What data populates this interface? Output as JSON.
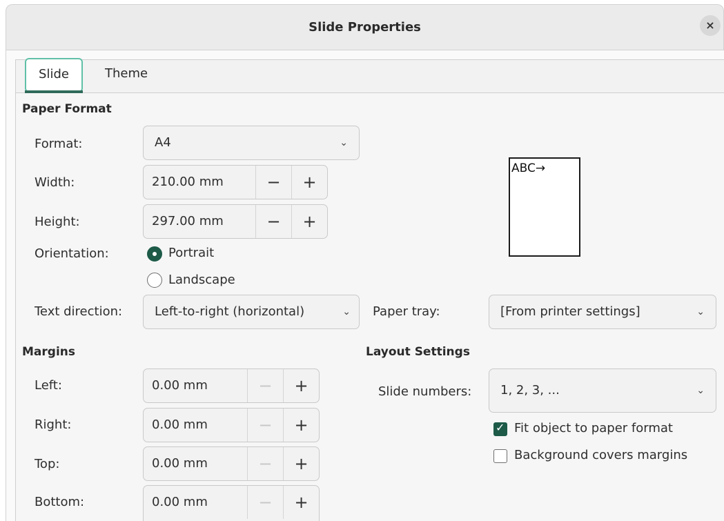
{
  "window": {
    "title": "Slide Properties",
    "close_glyph": "×"
  },
  "tabs": [
    {
      "label": "Slide",
      "active": true
    },
    {
      "label": "Theme",
      "active": false
    }
  ],
  "paper_format": {
    "heading": "Paper Format",
    "format": {
      "label": "Format:",
      "value": "A4"
    },
    "width": {
      "label": "Width:",
      "value": "210.00 mm"
    },
    "height": {
      "label": "Height:",
      "value": "297.00 mm"
    },
    "orientation": {
      "label": "Orientation:",
      "options": [
        {
          "label": "Portrait",
          "selected": true
        },
        {
          "label": "Landscape",
          "selected": false
        }
      ]
    },
    "text_direction": {
      "label": "Text direction:",
      "value": "Left-to-right (horizontal)"
    },
    "paper_tray": {
      "label": "Paper tray:",
      "value": "[From printer settings]"
    },
    "preview_text": "ABC→"
  },
  "margins": {
    "heading": "Margins",
    "left": {
      "label": "Left:",
      "value": "0.00 mm"
    },
    "right": {
      "label": "Right:",
      "value": "0.00 mm"
    },
    "top": {
      "label": "Top:",
      "value": "0.00 mm"
    },
    "bottom": {
      "label": "Bottom:",
      "value": "0.00 mm"
    }
  },
  "layout_settings": {
    "heading": "Layout Settings",
    "slide_numbers": {
      "label": "Slide numbers:",
      "value": "1, 2, 3, ..."
    },
    "fit_object": {
      "label": "Fit object to paper format",
      "checked": true
    },
    "background_covers": {
      "label": "Background covers margins",
      "checked": false
    }
  },
  "spin_glyphs": {
    "minus": "−",
    "plus": "+"
  },
  "chevron_glyph": "⌄",
  "colors": {
    "accent": "#1d5a48",
    "tab_focus": "#60c0a6"
  }
}
